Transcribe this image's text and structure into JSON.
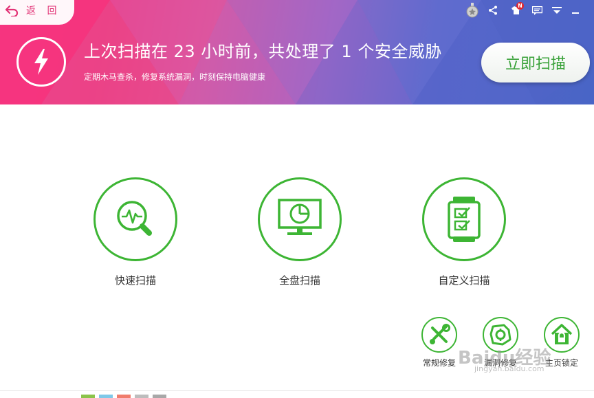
{
  "header": {
    "back_label": "返 回",
    "headline": "上次扫描在 23 小时前，共处理了 1 个安全威胁",
    "subline": "定期木马查杀，修复系统漏洞，时刻保持电脑健康",
    "scan_now_label": "立即扫描",
    "topbar_icons": [
      "medal-icon",
      "share-icon",
      "skin-shirt-icon",
      "message-icon",
      "menu-dropdown-icon"
    ],
    "notification_badge": "N",
    "colors": {
      "accent_green": "#3db534",
      "banner_pink": "#f2338a",
      "banner_blue": "#4865c6"
    }
  },
  "scan_options": [
    {
      "label": "快速扫描",
      "icon": "quick-scan-magnifier-icon"
    },
    {
      "label": "全盘扫描",
      "icon": "full-scan-monitor-icon"
    },
    {
      "label": "自定义扫描",
      "icon": "custom-scan-checklist-icon"
    }
  ],
  "tools": [
    {
      "label": "常规修复",
      "icon": "wrench-screwdriver-icon"
    },
    {
      "label": "漏洞修复",
      "icon": "vulnerability-repair-icon"
    },
    {
      "label": "主页锁定",
      "icon": "homepage-lock-icon"
    }
  ],
  "watermark": {
    "text": "Baidu经验",
    "url": "jingyan.baidu.com"
  }
}
